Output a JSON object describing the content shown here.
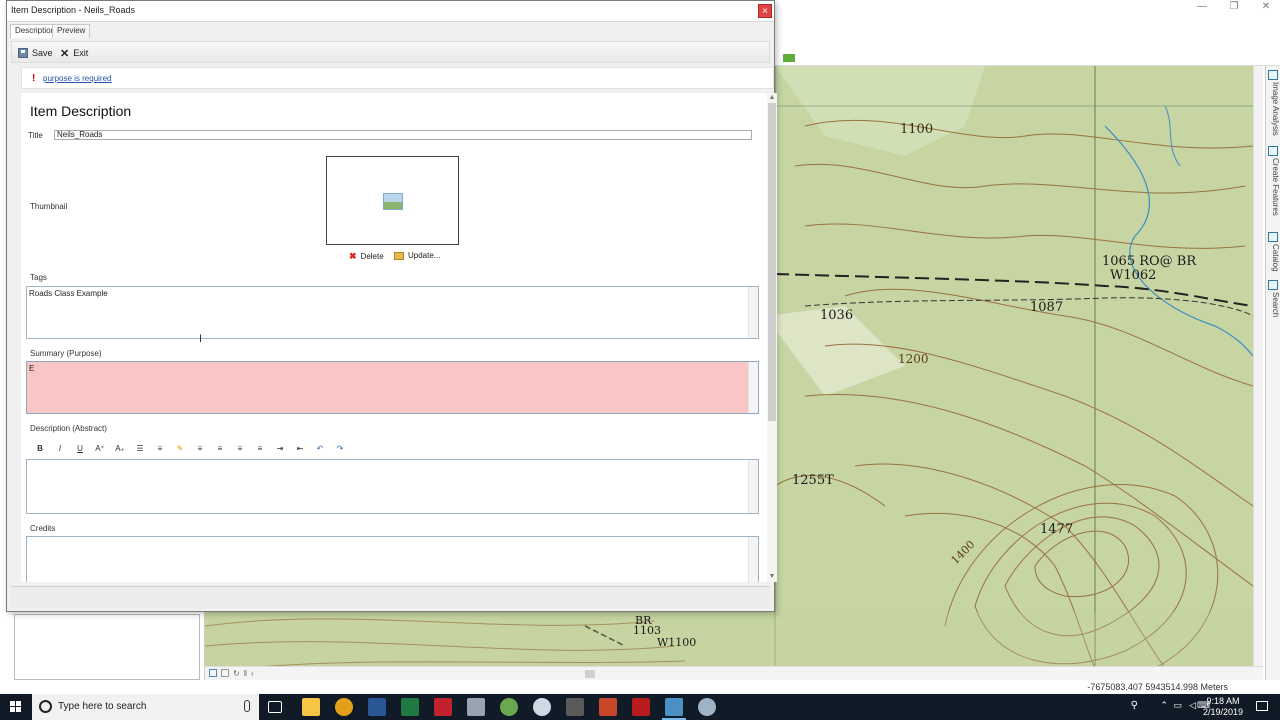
{
  "dialog": {
    "title": "Item Description - Neils_Roads",
    "close_glyph": "×",
    "tabs": [
      {
        "label": "Description"
      },
      {
        "label": "Preview"
      }
    ],
    "toolbar": {
      "save_label": "Save",
      "exit_label": "Exit"
    },
    "warning": {
      "icon": "!",
      "text": "purpose is required"
    },
    "content": {
      "heading": "Item Description",
      "title_label": "Title",
      "title_value": "Neils_Roads",
      "thumbnail_label": "Thumbnail",
      "thumbnail_actions": {
        "delete_label": "Delete",
        "update_label": "Update..."
      },
      "tags_label": "Tags",
      "tags_value": "Roads Class Example",
      "summary_label": "Summary (Purpose)",
      "summary_value": "E",
      "description_label": "Description (Abstract)",
      "description_value": "",
      "rte_buttons": [
        {
          "name": "bold-button",
          "glyph": "B"
        },
        {
          "name": "italic-button",
          "glyph": "I"
        },
        {
          "name": "underline-button",
          "glyph": "U"
        },
        {
          "name": "superscript-button",
          "glyph": "A⁺"
        },
        {
          "name": "subscript-button",
          "glyph": "A₊"
        },
        {
          "name": "bullet-list-button",
          "glyph": "☰"
        },
        {
          "name": "numbered-list-button",
          "glyph": "≡"
        },
        {
          "name": "highlight-button",
          "glyph": "✎"
        },
        {
          "name": "align-left-button",
          "glyph": "≡"
        },
        {
          "name": "align-center-button",
          "glyph": "≡"
        },
        {
          "name": "align-right-button",
          "glyph": "≡"
        },
        {
          "name": "justify-button",
          "glyph": "≡"
        },
        {
          "name": "indent-button",
          "glyph": "⇥"
        },
        {
          "name": "outdent-button",
          "glyph": "⇤"
        },
        {
          "name": "undo-button",
          "glyph": "↶"
        },
        {
          "name": "redo-button",
          "glyph": "↷"
        }
      ],
      "credits_label": "Credits",
      "credits_value": ""
    }
  },
  "map": {
    "labels": [
      {
        "text": "1100"
      },
      {
        "text": "1065 RO@ BR"
      },
      {
        "text": "W1062"
      },
      {
        "text": "1036"
      },
      {
        "text": "1087"
      },
      {
        "text": "1200"
      },
      {
        "text": "1255T"
      },
      {
        "text": "1477"
      },
      {
        "text": "1400"
      },
      {
        "text": "BR"
      },
      {
        "text": "1103"
      },
      {
        "text": "W1100"
      }
    ],
    "coordinates": "-7675083.407  5943514.998 Meters"
  },
  "right_dock": {
    "tabs": [
      "Image Analysis",
      "Create Features",
      "Catalog",
      "Search"
    ]
  },
  "taskbar": {
    "search_placeholder": "Type here to search",
    "time": "9:18 AM",
    "date": "2/19/2019",
    "apps": [
      {
        "name": "task-view-icon",
        "color": "#ffffff"
      },
      {
        "name": "file-explorer-icon",
        "color": "#f6c544"
      },
      {
        "name": "chrome-icon",
        "color": "#e4a01b"
      },
      {
        "name": "word-icon",
        "color": "#2b5797"
      },
      {
        "name": "excel-icon",
        "color": "#1f7a43"
      },
      {
        "name": "app-red-icon",
        "color": "#c2222f"
      },
      {
        "name": "arcmap-icon",
        "color": "#9aa4b0"
      },
      {
        "name": "qgis-icon",
        "color": "#6aa84f"
      },
      {
        "name": "arcgis-pro-icon",
        "color": "#cfd8e3"
      },
      {
        "name": "calculator-icon",
        "color": "#5a5a5a"
      },
      {
        "name": "powerpoint-icon",
        "color": "#c8472b"
      },
      {
        "name": "acrobat-icon",
        "color": "#b81b1b"
      },
      {
        "name": "arcgis-active-icon",
        "color": "#4a90c2"
      },
      {
        "name": "app-globe-icon",
        "color": "#9fb2c6"
      }
    ]
  },
  "colors": {
    "summary_error_bg": "#f9c6c6",
    "warning_icon": "#cc0000",
    "link": "#2255aa",
    "map_bg": "#c7d6a4"
  }
}
